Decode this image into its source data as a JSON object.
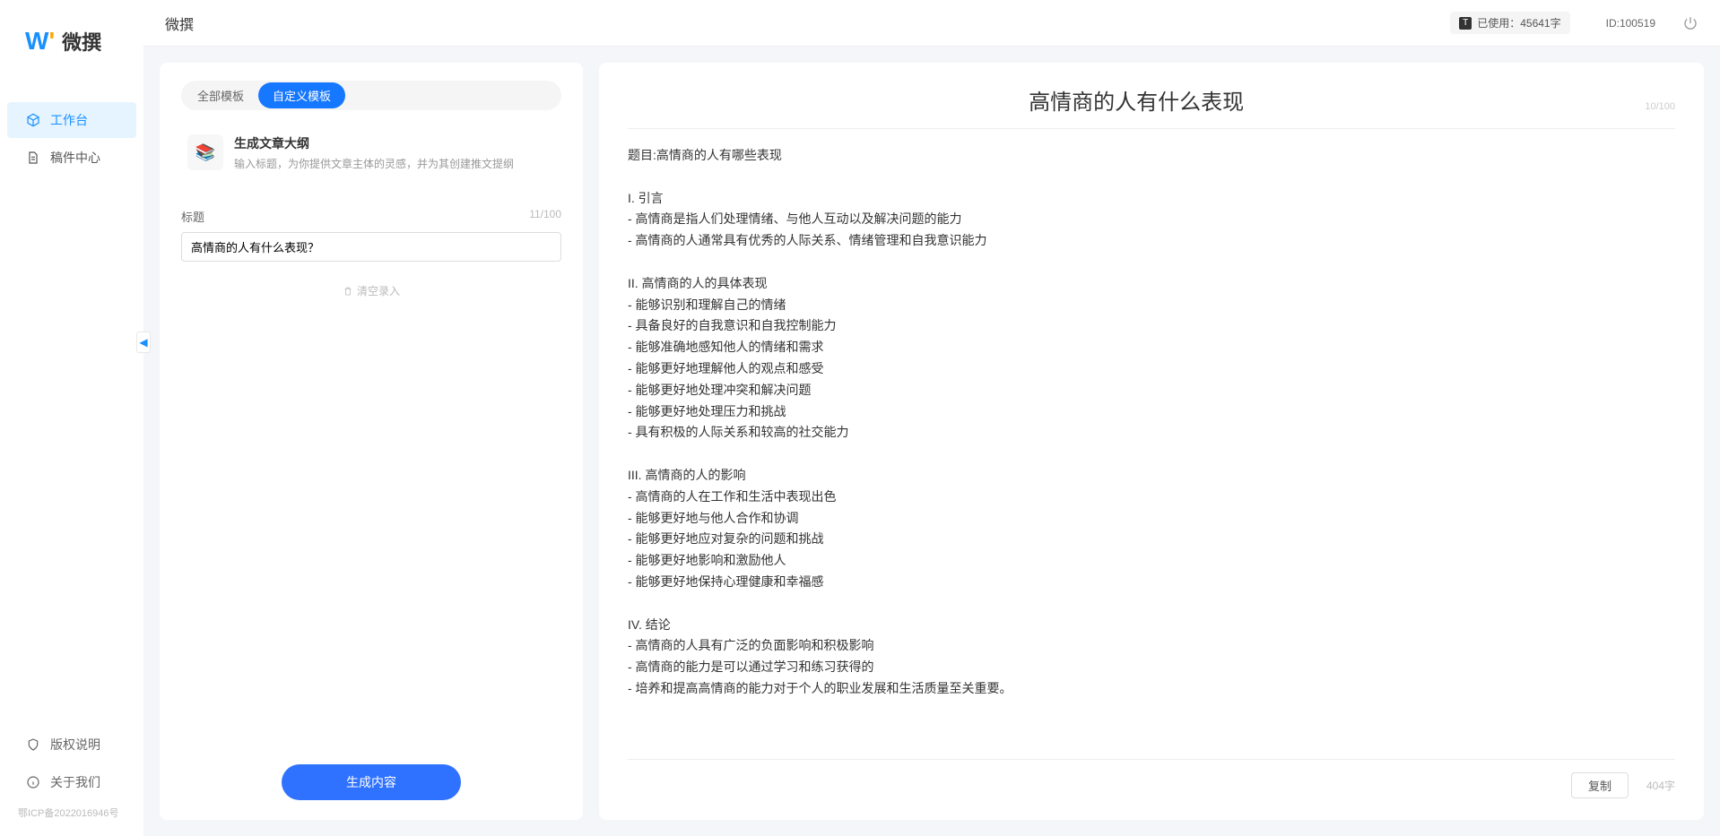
{
  "app_name": "微撰",
  "topbar": {
    "title": "微撰",
    "usage_label": "已使用：45641字",
    "user_id": "ID:100519"
  },
  "sidebar": {
    "nav": [
      {
        "label": "工作台",
        "active": true,
        "icon": "cube"
      },
      {
        "label": "稿件中心",
        "active": false,
        "icon": "doc"
      }
    ],
    "bottom": [
      {
        "label": "版权说明",
        "icon": "shield"
      },
      {
        "label": "关于我们",
        "icon": "info"
      }
    ],
    "footer": "鄂ICP备2022016946号"
  },
  "left": {
    "tabs": [
      "全部模板",
      "自定义模板"
    ],
    "active_tab": 1,
    "template": {
      "title": "生成文章大纲",
      "desc": "输入标题，为你提供文章主体的灵感，并为其创建推文提纲"
    },
    "field_label": "标题",
    "field_counter": "11/100",
    "input_value": "高情商的人有什么表现？",
    "clear_label": "清空录入",
    "generate_label": "生成内容"
  },
  "right": {
    "title": "高情商的人有什么表现",
    "title_counter": "10/100",
    "body": "题目:高情商的人有哪些表现\n\nI. 引言\n- 高情商是指人们处理情绪、与他人互动以及解决问题的能力\n- 高情商的人通常具有优秀的人际关系、情绪管理和自我意识能力\n\nII. 高情商的人的具体表现\n- 能够识别和理解自己的情绪\n- 具备良好的自我意识和自我控制能力\n- 能够准确地感知他人的情绪和需求\n- 能够更好地理解他人的观点和感受\n- 能够更好地处理冲突和解决问题\n- 能够更好地处理压力和挑战\n- 具有积极的人际关系和较高的社交能力\n\nIII. 高情商的人的影响\n- 高情商的人在工作和生活中表现出色\n- 能够更好地与他人合作和协调\n- 能够更好地应对复杂的问题和挑战\n- 能够更好地影响和激励他人\n- 能够更好地保持心理健康和幸福感\n\nIV. 结论\n- 高情商的人具有广泛的负面影响和积极影响\n- 高情商的能力是可以通过学习和练习获得的\n- 培养和提高高情商的能力对于个人的职业发展和生活质量至关重要。",
    "copy_label": "复制",
    "char_count": "404字"
  }
}
